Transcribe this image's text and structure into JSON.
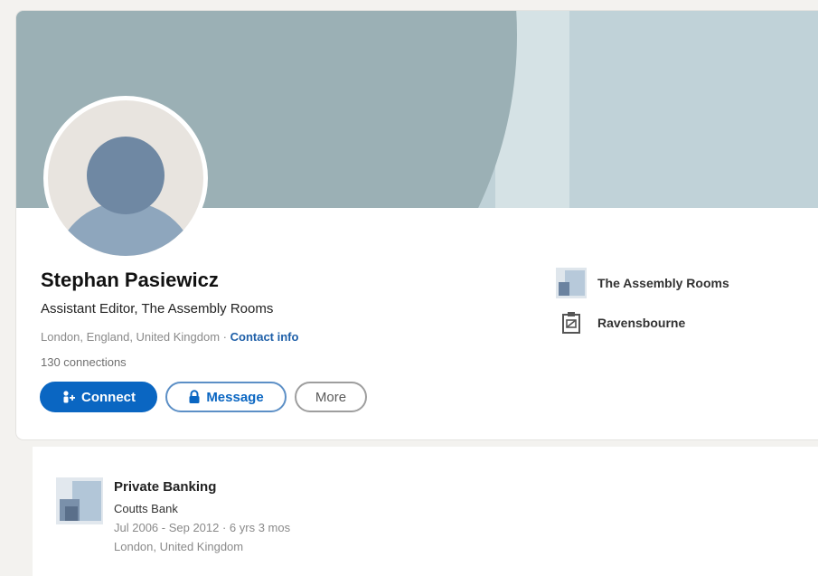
{
  "profile": {
    "name": "Stephan Pasiewicz",
    "headline": "Assistant Editor, The Assembly Rooms",
    "location": "London, England, United Kingdom",
    "separator": " · ",
    "contact_info_label": "Contact info",
    "connections": "130 connections"
  },
  "actions": {
    "connect_label": "Connect",
    "message_label": "Message",
    "more_label": "More"
  },
  "organizations": [
    {
      "label": "The Assembly Rooms",
      "icon": "company-logo-icon"
    },
    {
      "label": "Ravensbourne",
      "icon": "school-icon"
    }
  ],
  "experience": {
    "title": "Private Banking",
    "company": "Coutts Bank",
    "dates": "Jul 2006 - Sep 2012 · 6 yrs 3 mos",
    "location": "London, United Kingdom"
  },
  "colors": {
    "primary": "#0a66c2",
    "link": "#1e5fa8",
    "cover_dark": "#9bb0b5",
    "cover_light": "#c0d2d8",
    "avatar_head": "#6f88a3",
    "avatar_body": "#8ea6bd"
  }
}
